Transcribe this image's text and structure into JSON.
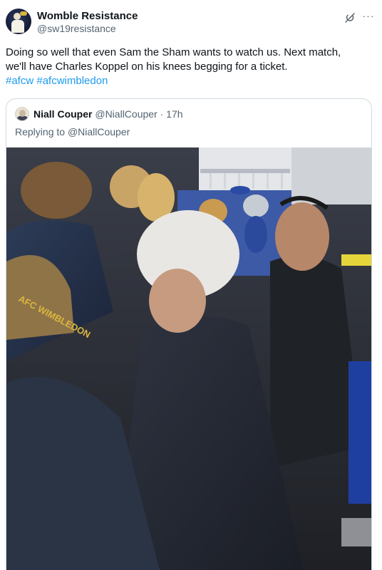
{
  "tweet": {
    "author_name": "Womble Resistance",
    "author_handle": "@sw19resistance",
    "text_line1": "Doing so well that even Sam the Sham wants to watch us. Next match,",
    "text_line2": "we'll have Charles Koppel on his knees begging for a ticket.",
    "hashtags": [
      "#afcw",
      "#afcwimbledon"
    ],
    "more_label": "···"
  },
  "quoted": {
    "author_name": "Niall Couper",
    "author_handle": "@NiallCouper",
    "separator": "·",
    "time": "17h",
    "replying_prefix": "Replying to ",
    "replying_to": "@NiallCouper",
    "cap_text": "AFC WIMBLEDON"
  },
  "icons": {
    "avatar": "womble-avatar",
    "grok": "grok-icon",
    "more": "more-icon",
    "quoted_avatar": "niall-avatar"
  },
  "colors": {
    "link": "#1d9bf0",
    "text": "#0f1419",
    "secondary": "#536471",
    "border": "#cfd9de"
  }
}
